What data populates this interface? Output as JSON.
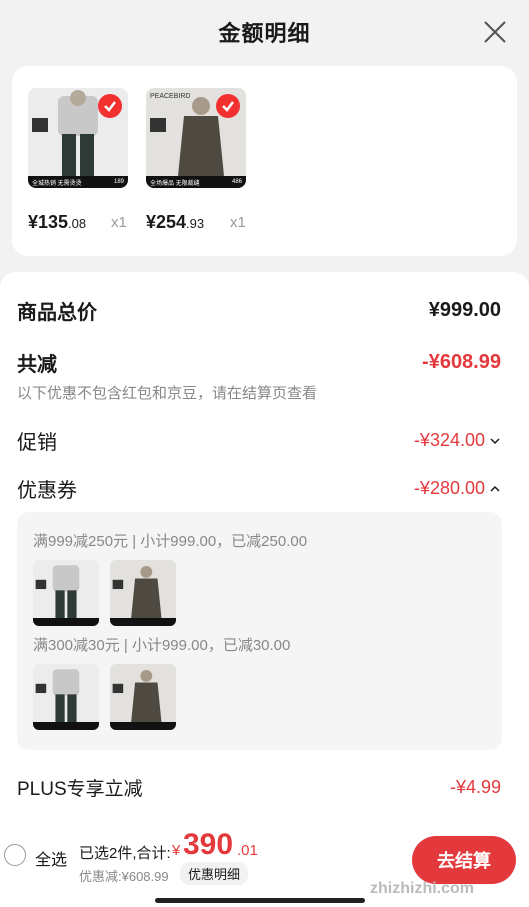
{
  "header": {
    "title": "金额明细"
  },
  "products": [
    {
      "price_main": "¥135",
      "price_cents": ".08",
      "qty": "x1",
      "badge": "189",
      "caption": "全城热销 无需烫烫"
    },
    {
      "price_main": "¥254",
      "price_cents": ".93",
      "qty": "x1",
      "badge": "486",
      "caption": "全场爆品 无限裁缝",
      "brand": "PEACEBIRD"
    }
  ],
  "summary": {
    "total_label": "商品总价",
    "total_value": "¥999.00",
    "reduce_label": "共减",
    "reduce_value": "-¥608.99",
    "note": "以下优惠不包含红包和京豆，请在结算页查看",
    "promo_label": "促销",
    "promo_value": "-¥324.00",
    "coupon_label": "优惠券",
    "coupon_value": "-¥280.00",
    "plus_label": "PLUS专享立减",
    "plus_value": "-¥4.99"
  },
  "coupons": [
    {
      "title": "满999减250元 | 小计999.00，已减250.00"
    },
    {
      "title": "满300减30元 | 小计999.00，已减30.00"
    }
  ],
  "bottom": {
    "select_all": "全选",
    "selected": "已选2件,合计:",
    "currency": "¥",
    "total_int": "390",
    "total_dec": ".01",
    "discount": "优惠减:¥608.99",
    "detail_chip": "优惠明细",
    "checkout": "去结算",
    "watermark": "zhizhizhi.com"
  },
  "colors": {
    "accent": "#e4393c",
    "check": "#f23030"
  },
  "icons": [
    "close-icon",
    "check-icon",
    "chevron-down-icon",
    "chevron-up-icon"
  ]
}
